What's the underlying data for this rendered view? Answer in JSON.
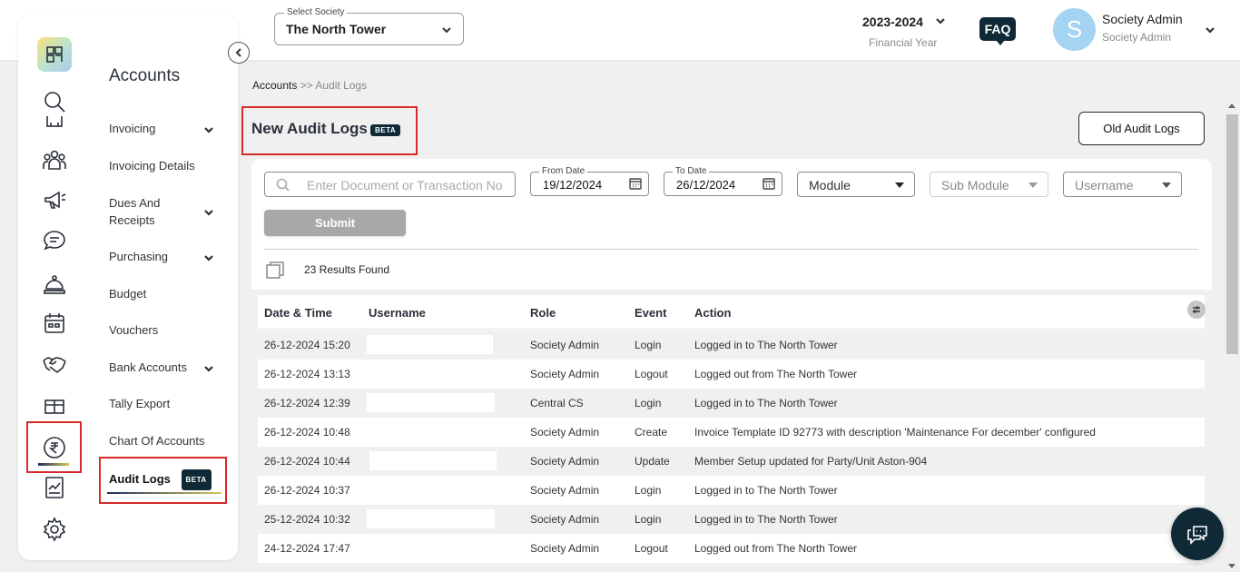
{
  "header": {
    "society_label": "Select Society",
    "society_value": "The North Tower",
    "financial_year": "2023-2024",
    "financial_year_label": "Financial Year",
    "faq_label": "FAQ",
    "avatar_letter": "S",
    "user_name": "Society Admin",
    "user_role": "Society Admin"
  },
  "sidebar": {
    "section_title": "Accounts",
    "items": [
      {
        "label": "Invoicing",
        "has_submenu": true
      },
      {
        "label": "Invoicing Details",
        "has_submenu": false
      },
      {
        "label": "Dues And Receipts",
        "has_submenu": true
      },
      {
        "label": "Purchasing",
        "has_submenu": true
      },
      {
        "label": "Budget",
        "has_submenu": false
      },
      {
        "label": "Vouchers",
        "has_submenu": false
      },
      {
        "label": "Bank Accounts",
        "has_submenu": true
      },
      {
        "label": "Tally Export",
        "has_submenu": false
      },
      {
        "label": "Chart Of Accounts",
        "has_submenu": false
      },
      {
        "label": "Audit Logs",
        "has_submenu": false,
        "active": true,
        "badge": "BETA"
      }
    ],
    "rail_icons": [
      "search-icon",
      "building-icon",
      "people-icon",
      "megaphone-icon",
      "chat-icon",
      "reception-bell-icon",
      "calendar-icon",
      "handshake-icon",
      "gift-icon",
      "rupee-icon",
      "report-icon",
      "settings-icon"
    ]
  },
  "breadcrumb": {
    "parent": "Accounts",
    "separator": " >> ",
    "current": "Audit Logs"
  },
  "page": {
    "title": "New Audit Logs",
    "title_badge": "BETA",
    "old_logs_button": "Old Audit Logs"
  },
  "filters": {
    "search_placeholder": "Enter Document or Transaction No",
    "from_date_label": "From Date",
    "from_date_value": "19/12/2024",
    "to_date_label": "To Date",
    "to_date_value": "26/12/2024",
    "module": "Module",
    "sub_module": "Sub Module",
    "username": "Username",
    "submit_label": "Submit",
    "results_text": "23 Results Found"
  },
  "table": {
    "columns": [
      "Date & Time",
      "Username",
      "Role",
      "Event",
      "Action"
    ],
    "rows": [
      {
        "datetime": "26-12-2024 15:20",
        "role": "Society Admin",
        "event": "Login",
        "action": "Logged in to The North Tower"
      },
      {
        "datetime": "26-12-2024 13:13",
        "role": "Society Admin",
        "event": "Logout",
        "action": "Logged out from The North Tower"
      },
      {
        "datetime": "26-12-2024 12:39",
        "role": "Central CS",
        "event": "Login",
        "action": "Logged in to The North Tower"
      },
      {
        "datetime": "26-12-2024 10:48",
        "role": "Society Admin",
        "event": "Create",
        "action": "Invoice Template ID 92773 with description 'Maintenance For december' configured"
      },
      {
        "datetime": "26-12-2024 10:44",
        "role": "Society Admin",
        "event": "Update",
        "action": "Member Setup updated for Party/Unit Aston-904"
      },
      {
        "datetime": "26-12-2024 10:37",
        "role": "Society Admin",
        "event": "Login",
        "action": "Logged in to The North Tower"
      },
      {
        "datetime": "25-12-2024 10:32",
        "role": "Society Admin",
        "event": "Login",
        "action": "Logged in to The North Tower"
      },
      {
        "datetime": "24-12-2024 17:47",
        "role": "Society Admin",
        "event": "Logout",
        "action": "Logged out from The North Tower"
      }
    ]
  },
  "colors": {
    "brand_dark": "#0f2a36",
    "highlight_red": "#d62b2b",
    "avatar": "#a5d3f2"
  }
}
